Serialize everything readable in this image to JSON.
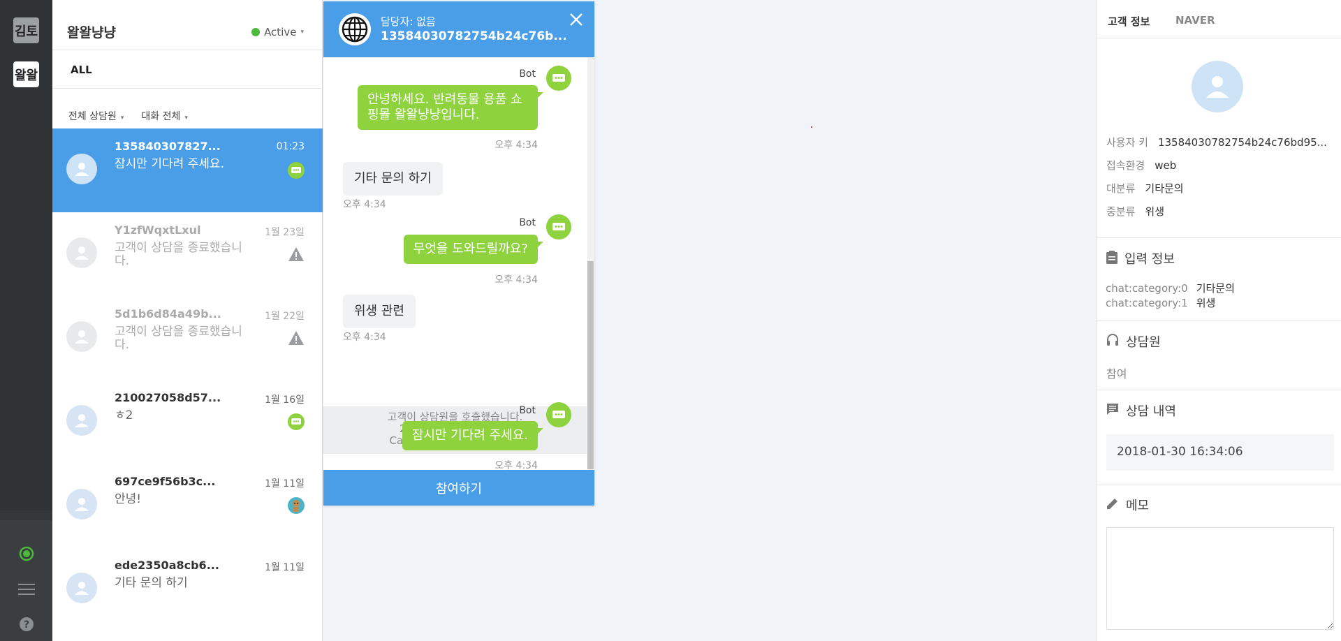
{
  "workspaces": [
    {
      "label": "김토"
    },
    {
      "label": "왈왈"
    }
  ],
  "list": {
    "brand": "왈왈냥냥",
    "status": "Active",
    "tab": "ALL",
    "filter_agent": "전체 상담원",
    "filter_chat": "대화 전체",
    "items": [
      {
        "name": "135840307827...",
        "date": "01:23",
        "msg": "잠시만 기다려 주세요.",
        "badge": "bot-icon"
      },
      {
        "name": "Y1zfWqxtLxul",
        "date": "1월 23일",
        "msg": "고객이 상담을 종료했습니다.",
        "badge": "warning-icon"
      },
      {
        "name": "5d1b6d84a49b...",
        "date": "1월 22일",
        "msg": "고객이 상담을 종료했습니다.",
        "badge": "warning-icon"
      },
      {
        "name": "210027058d57...",
        "date": "1월 16일",
        "msg": "ㅎ2",
        "badge": "bot-icon"
      },
      {
        "name": "697ce9f56b3c...",
        "date": "1월 11일",
        "msg": "안녕!",
        "badge": "agent-avatar-icon"
      },
      {
        "name": "ede2350a8cb6...",
        "date": "1월 11일",
        "msg": "기타 문의 하기",
        "badge": ""
      }
    ]
  },
  "chat": {
    "assignee": "담당자: 없음",
    "customer_id": "13584030782754b24c76b...",
    "bot_label": "Bot",
    "messages": [
      {
        "from": "bot",
        "text": "안녕하세요. 반려동물 용품 쇼핑몰 왈왈냥냥입니다.",
        "time": "오후 4:34"
      },
      {
        "from": "user",
        "text": "기타 문의 하기",
        "time": "오후 4:34"
      },
      {
        "from": "bot",
        "text": "무엇을 도와드릴까요?",
        "time": "오후 4:34"
      },
      {
        "from": "user",
        "text": "위생 관련",
        "time": "오후 4:34"
      },
      {
        "from": "bot",
        "text": "잠시만 기다려 주세요.",
        "time": "오후 4:34"
      }
    ],
    "system": {
      "line1": "고객이 상담원을 호출했습니다.",
      "line2": "2018-01-30 16:34:47",
      "line3": "Category : 기타문의 > 위생"
    },
    "join_button": "참여하기"
  },
  "panel": {
    "tab_info": "고객 정보",
    "tab_naver": "NAVER",
    "user_key_label": "사용자 키",
    "user_key": "13584030782754b24c76bd95...",
    "env_label": "접속환경",
    "env": "web",
    "cat1_label": "대분류",
    "cat1": "기타문의",
    "cat2_label": "중분류",
    "cat2": "위생",
    "input_title": "입력 정보",
    "inputs": [
      {
        "key": "chat:category:0",
        "value": "기타문의"
      },
      {
        "key": "chat:category:1",
        "value": "위생"
      }
    ],
    "agent_title": "상담원",
    "agent_value": "참여",
    "history_title": "상담 내역",
    "history_item": "2018-01-30 16:34:06",
    "memo_title": "메모"
  },
  "colors": {
    "accent": "#4a9ee8",
    "bot_green": "#8ed23e",
    "active_dot": "#4cbb3c",
    "rail": "#2f3336"
  }
}
